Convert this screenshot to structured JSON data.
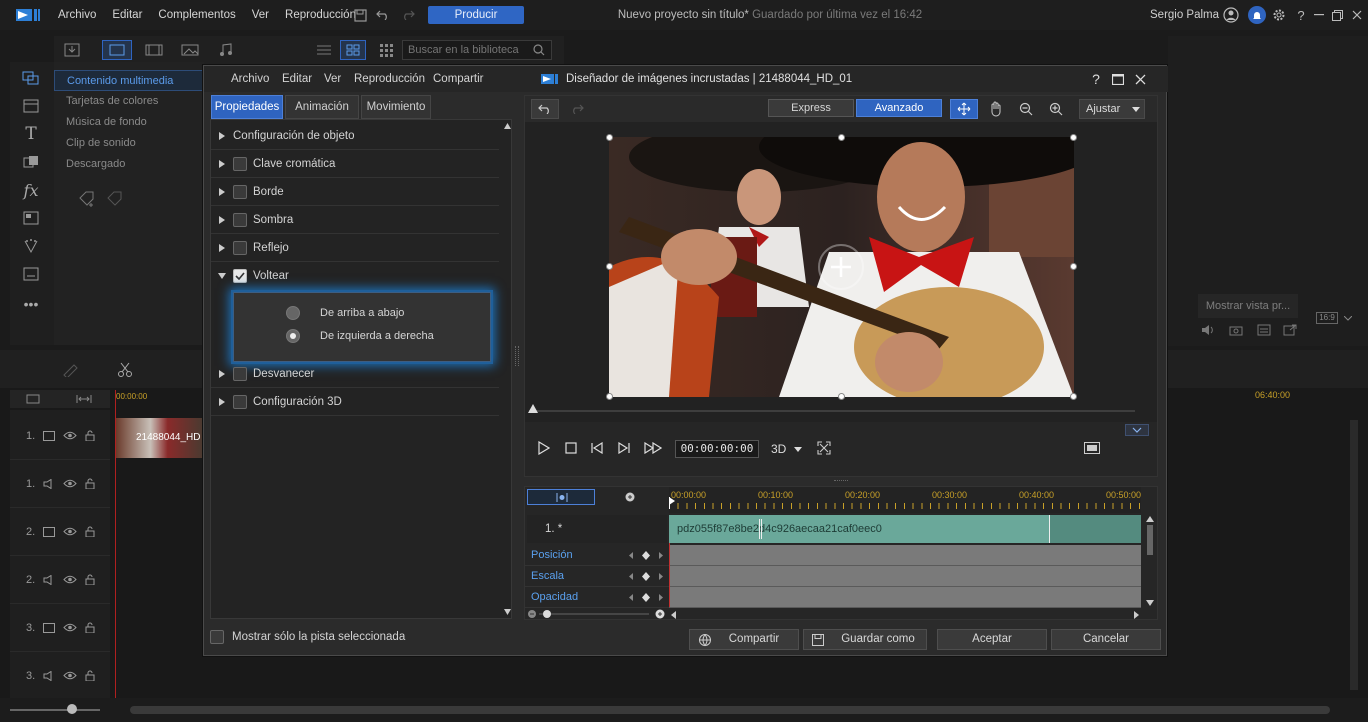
{
  "app": {
    "menu": [
      "Archivo",
      "Editar",
      "Complementos",
      "Ver",
      "Reproducción"
    ],
    "produce_label": "Producir",
    "project_title": "Nuevo proyecto sin título*",
    "saved_status": "Guardado por última vez el 16:42",
    "user_name": "Sergio Palma"
  },
  "library": {
    "search_placeholder": "Buscar en la biblioteca",
    "items": [
      "Contenido multimedia",
      "Tarjetas de colores",
      "Música de fondo",
      "Clip de sonido",
      "Descargado"
    ],
    "active_index": 0
  },
  "right_panel": {
    "preview_button": "Mostrar vista pr...",
    "aspect": "16:9",
    "time_end": "06:40:00"
  },
  "timeline": {
    "time_start": "00:00:00",
    "tracks": [
      "1.",
      "1.",
      "2.",
      "2.",
      "3.",
      "3."
    ],
    "clip_label": "21488044_HD"
  },
  "dialog": {
    "menu": [
      "Archivo",
      "Editar",
      "Ver",
      "Reproducción",
      "Compartir"
    ],
    "title": "Diseñador de imágenes incrustadas  |  21488044_HD_01",
    "tabs": [
      "Propiedades",
      "Animación",
      "Movimiento"
    ],
    "active_tab": 0,
    "properties": [
      {
        "label": "Configuración de objeto",
        "has_checkbox": false,
        "checked": false
      },
      {
        "label": "Clave cromática",
        "has_checkbox": true,
        "checked": false
      },
      {
        "label": "Borde",
        "has_checkbox": true,
        "checked": false
      },
      {
        "label": "Sombra",
        "has_checkbox": true,
        "checked": false
      },
      {
        "label": "Reflejo",
        "has_checkbox": true,
        "checked": false
      },
      {
        "label": "Voltear",
        "has_checkbox": true,
        "checked": true
      },
      {
        "label": "Desvanecer",
        "has_checkbox": true,
        "checked": false
      },
      {
        "label": "Configuración 3D",
        "has_checkbox": true,
        "checked": false
      }
    ],
    "flip_options": [
      {
        "label": "De arriba a abajo",
        "selected": false
      },
      {
        "label": "De izquierda a derecha",
        "selected": true
      }
    ],
    "mode_tabs": [
      "Express",
      "Avanzado"
    ],
    "active_mode": 1,
    "fit_label": "Ajustar",
    "timecode": "00:00:00:00",
    "mode_3d": "3D",
    "kf_ruler": [
      "00:00:00",
      "00:10:00",
      "00:20:00",
      "00:30:00",
      "00:40:00",
      "00:50:00"
    ],
    "kf_track": "1. *",
    "kf_clip": "pdz055f87e8be2d4c926aecaa21caf0eec0",
    "kf_rows": [
      "Posición",
      "Escala",
      "Opacidad"
    ],
    "show_only_label": "Mostrar sólo la pista seleccionada",
    "buttons": {
      "share": "Compartir",
      "save_as": "Guardar como",
      "accept": "Aceptar",
      "cancel": "Cancelar"
    }
  },
  "colors": {
    "accent": "#2f64c0",
    "clip": "#6aa89a",
    "link": "#5aa0ee"
  }
}
